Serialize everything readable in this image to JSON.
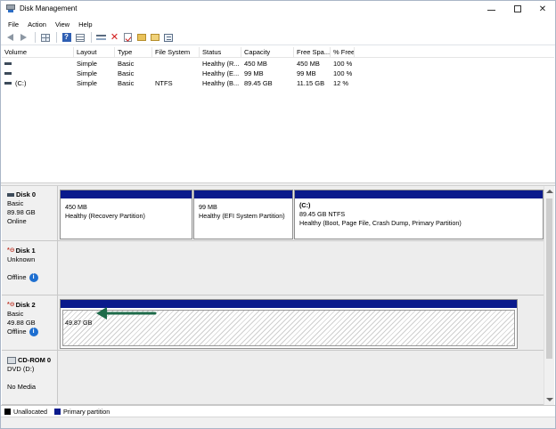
{
  "window": {
    "title": "Disk Management"
  },
  "menu": {
    "items": [
      "File",
      "Action",
      "View",
      "Help"
    ]
  },
  "volume_list": {
    "columns": [
      "Volume",
      "Layout",
      "Type",
      "File System",
      "Status",
      "Capacity",
      "Free Spa...",
      "% Free"
    ],
    "rows": [
      {
        "volume": "",
        "layout": "Simple",
        "type": "Basic",
        "fs": "",
        "status": "Healthy (R...",
        "capacity": "450 MB",
        "free": "450 MB",
        "pct": "100 %"
      },
      {
        "volume": "",
        "layout": "Simple",
        "type": "Basic",
        "fs": "",
        "status": "Healthy (E...",
        "capacity": "99 MB",
        "free": "99 MB",
        "pct": "100 %"
      },
      {
        "volume": "(C:)",
        "layout": "Simple",
        "type": "Basic",
        "fs": "NTFS",
        "status": "Healthy (B...",
        "capacity": "89.45 GB",
        "free": "11.15 GB",
        "pct": "12 %"
      }
    ]
  },
  "disks": [
    {
      "name": "Disk 0",
      "type": "Basic",
      "size": "89.98 GB",
      "state": "Online",
      "partitions": [
        {
          "name": "",
          "size": "450 MB",
          "status": "Healthy (Recovery Partition)"
        },
        {
          "name": "",
          "size": "99 MB",
          "status": "Healthy (EFI System Partition)"
        },
        {
          "name": "(C:)",
          "size": "89.45 GB NTFS",
          "status": "Healthy (Boot, Page File, Crash Dump, Primary Partition)"
        }
      ]
    },
    {
      "name": "Disk 1",
      "type": "Unknown",
      "size": "",
      "state": "Offline"
    },
    {
      "name": "Disk 2",
      "type": "Basic",
      "size": "49.88 GB",
      "state": "Offline",
      "block": {
        "size": "49.87 GB"
      }
    },
    {
      "name": "CD-ROM 0",
      "type": "DVD (D:)",
      "size": "",
      "state": "No Media"
    }
  ],
  "legend": {
    "unallocated": "Unallocated",
    "primary": "Primary partition"
  },
  "colors": {
    "primary_bar": "#0a1a8c",
    "unallocated": "#000000",
    "arrow": "#1f6b4a",
    "info": "#1e6fd0"
  }
}
